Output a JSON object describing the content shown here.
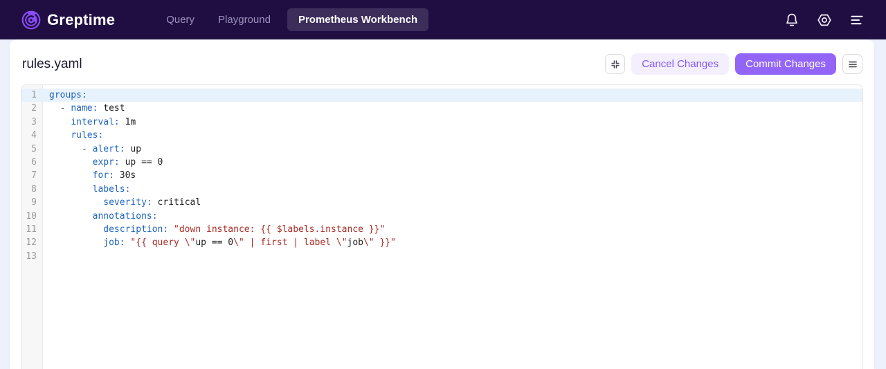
{
  "header": {
    "brand": "Greptime",
    "nav": [
      {
        "label": "Query",
        "active": false
      },
      {
        "label": "Playground",
        "active": false
      },
      {
        "label": "Prometheus Workbench",
        "active": true
      }
    ],
    "icons": [
      "notification-bell-icon",
      "settings-hexagon-icon",
      "menu-lines-icon"
    ]
  },
  "toolbar": {
    "title": "rules.yaml",
    "cancel_label": "Cancel Changes",
    "commit_label": "Commit Changes",
    "icon_buttons": [
      "collapse-expand-icon",
      "editor-menu-icon"
    ]
  },
  "editor": {
    "language": "yaml",
    "active_line": 1,
    "lines": [
      {
        "num": 1,
        "tokens": [
          {
            "t": "key",
            "v": "groups:"
          }
        ]
      },
      {
        "num": 2,
        "tokens": [
          {
            "t": "meta",
            "v": "  - "
          },
          {
            "t": "key",
            "v": "name:"
          },
          {
            "t": "plain",
            "v": " test"
          }
        ]
      },
      {
        "num": 3,
        "tokens": [
          {
            "t": "plain",
            "v": "    "
          },
          {
            "t": "key",
            "v": "interval:"
          },
          {
            "t": "plain",
            "v": " 1m"
          }
        ]
      },
      {
        "num": 4,
        "tokens": [
          {
            "t": "plain",
            "v": "    "
          },
          {
            "t": "key",
            "v": "rules:"
          }
        ]
      },
      {
        "num": 5,
        "tokens": [
          {
            "t": "meta",
            "v": "      - "
          },
          {
            "t": "key",
            "v": "alert:"
          },
          {
            "t": "plain",
            "v": " up"
          }
        ]
      },
      {
        "num": 6,
        "tokens": [
          {
            "t": "plain",
            "v": "        "
          },
          {
            "t": "key",
            "v": "expr:"
          },
          {
            "t": "plain",
            "v": " up == 0"
          }
        ]
      },
      {
        "num": 7,
        "tokens": [
          {
            "t": "plain",
            "v": "        "
          },
          {
            "t": "key",
            "v": "for:"
          },
          {
            "t": "plain",
            "v": " 30s"
          }
        ]
      },
      {
        "num": 8,
        "tokens": [
          {
            "t": "plain",
            "v": "        "
          },
          {
            "t": "key",
            "v": "labels:"
          }
        ]
      },
      {
        "num": 9,
        "tokens": [
          {
            "t": "plain",
            "v": "          "
          },
          {
            "t": "key",
            "v": "severity:"
          },
          {
            "t": "plain",
            "v": " critical"
          }
        ]
      },
      {
        "num": 10,
        "tokens": [
          {
            "t": "plain",
            "v": "        "
          },
          {
            "t": "key",
            "v": "annotations:"
          }
        ]
      },
      {
        "num": 11,
        "tokens": [
          {
            "t": "plain",
            "v": "          "
          },
          {
            "t": "key",
            "v": "description:"
          },
          {
            "t": "plain",
            "v": " "
          },
          {
            "t": "str",
            "v": "\"down instance: {{ $labels.instance }}\""
          }
        ]
      },
      {
        "num": 12,
        "tokens": [
          {
            "t": "plain",
            "v": "          "
          },
          {
            "t": "key",
            "v": "job:"
          },
          {
            "t": "plain",
            "v": " "
          },
          {
            "t": "str",
            "v": "\"{{ query \\\""
          },
          {
            "t": "plain",
            "v": "up == 0"
          },
          {
            "t": "str",
            "v": "\\\" | first | label \\\""
          },
          {
            "t": "plain",
            "v": "job"
          },
          {
            "t": "str",
            "v": "\\\" }}\""
          }
        ]
      },
      {
        "num": 13,
        "tokens": []
      }
    ]
  },
  "colors": {
    "header_bg": "#200e43",
    "page_bg": "#edf1fc",
    "brand_purple": "#8a4cf6",
    "nav_inactive": "#9c93bb",
    "active_pill_bg": "rgba(255,255,255,0.13)",
    "commit_bg": "#9365f7",
    "cancel_bg": "#f4effe",
    "cancel_text": "#8655f2",
    "yaml_key": "#2166c0",
    "yaml_string": "#ad2b26",
    "active_line_bg": "#e8f2fc",
    "gutter_bg": "#f7f7f7"
  }
}
